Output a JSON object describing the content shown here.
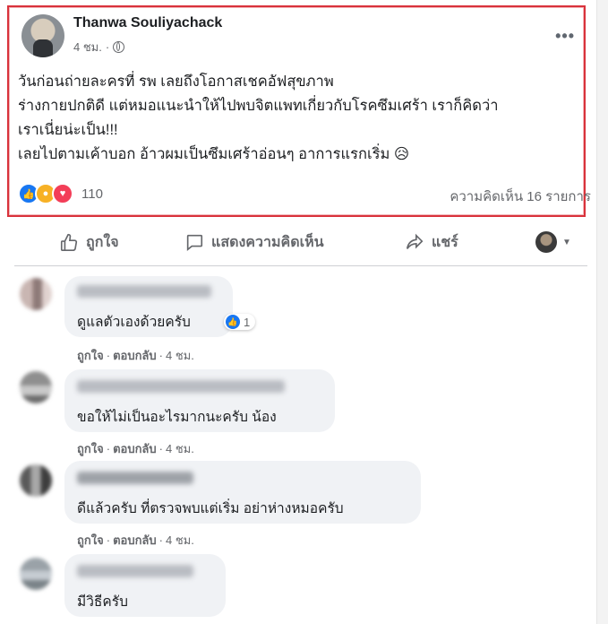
{
  "post": {
    "author": "Thanwa Souliyachack",
    "time": "4 ชม.",
    "more_icon": "ellipsis-icon",
    "lines": [
      "วันก่อนถ่ายละครที่ รพ เลยถึงโอกาสเชคอัฟสุขภาพ",
      "ร่างกายปกติดี แต่หมอแนะนำให้ไปพบจิตแพทเกี่ยวกับโรคซึมเศร้า เราก็คิดว่า",
      "เราเนี่ยน่ะเป็น!!!",
      "เลยไปตามเค้าบอก อ้าวผมเป็นซึมเศร้าอ่อนๆ อาการแรกเริ่ม 😥"
    ],
    "reaction_count": "110",
    "comment_count": "ความคิดเห็น 16 รายการ"
  },
  "actions": {
    "like": "ถูกใจ",
    "comment": "แสดงความคิดเห็น",
    "share": "แชร์"
  },
  "comments": [
    {
      "text": "ดูแลตัวเองด้วยครับ",
      "like": "ถูกใจ",
      "reply": "ตอบกลับ",
      "time": "4 ชม.",
      "reactions": "1"
    },
    {
      "text": "ขอให้ไม่เป็นอะไรมากนะครับ น้อง",
      "like": "ถูกใจ",
      "reply": "ตอบกลับ",
      "time": "4 ชม."
    },
    {
      "text": "ดีแล้วครับ ที่ตรวจพบแต่เริ่ม อย่าห่างหมอครับ",
      "like": "ถูกใจ",
      "reply": "ตอบกลับ",
      "time": "4 ชม."
    },
    {
      "text": "มีวิธีครับ"
    }
  ],
  "colors": {
    "accent": "#1877f2",
    "highlight_border": "#d9323b",
    "bubble": "#f0f2f5"
  }
}
